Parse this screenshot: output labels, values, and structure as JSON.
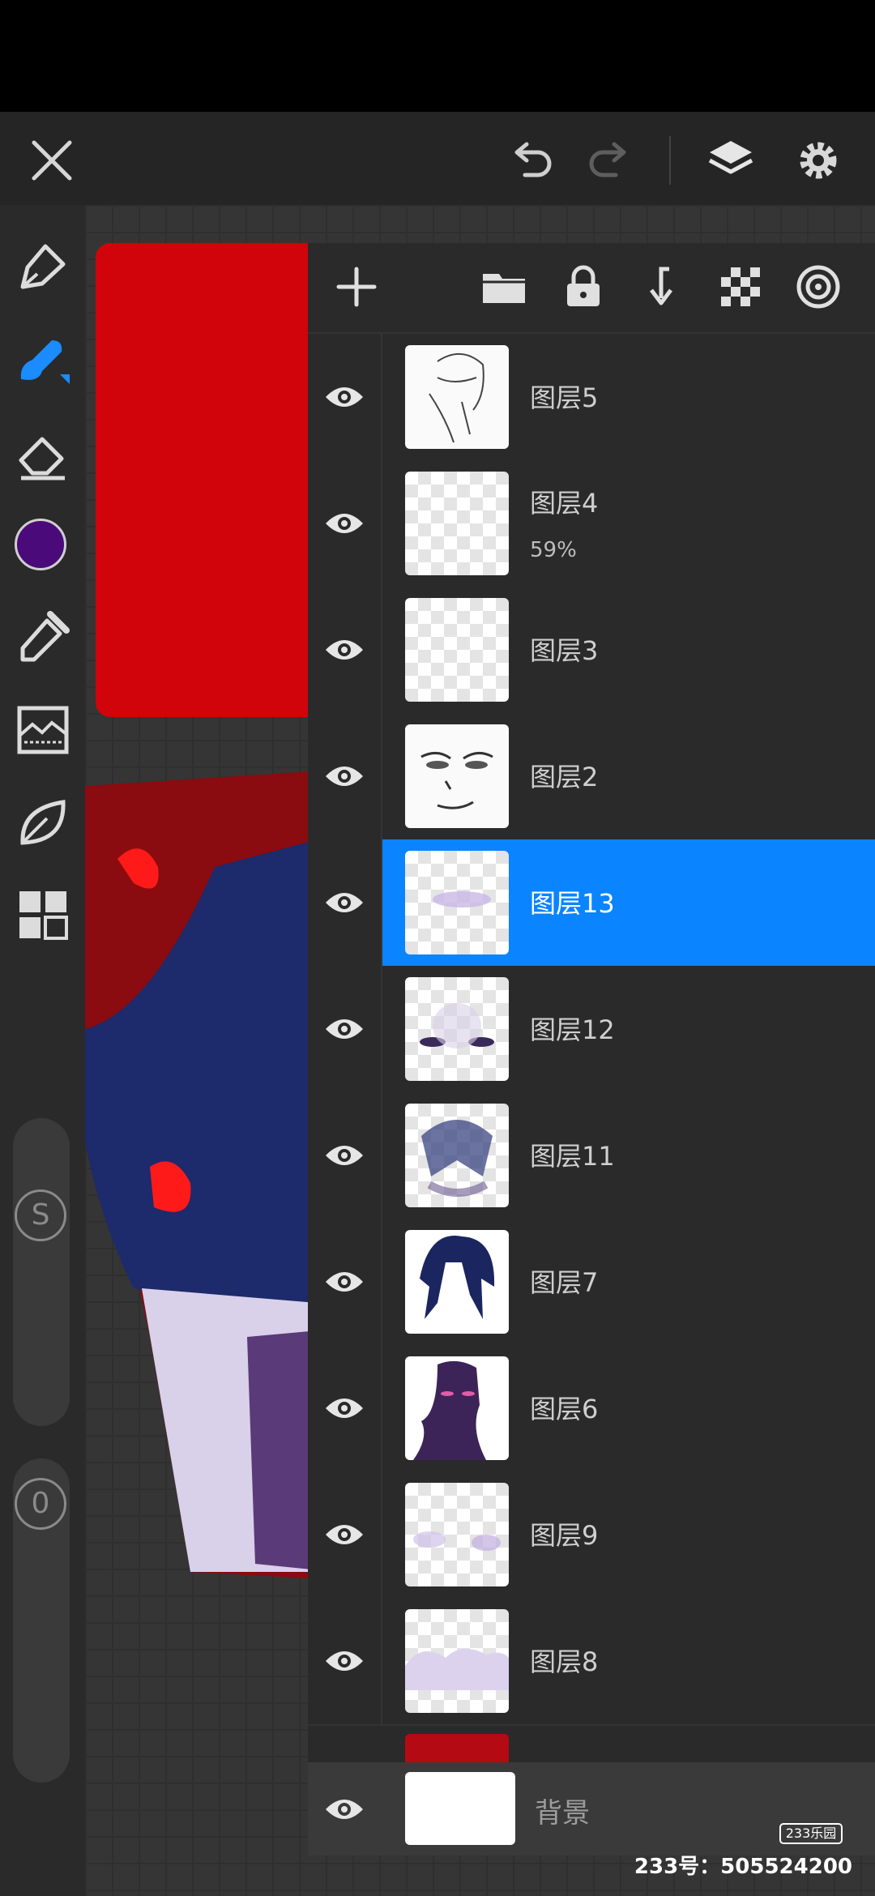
{
  "layers_panel": {
    "layers": [
      {
        "name": "图层5",
        "opacity": ""
      },
      {
        "name": "图层4",
        "opacity": "59%"
      },
      {
        "name": "图层3",
        "opacity": ""
      },
      {
        "name": "图层2",
        "opacity": ""
      },
      {
        "name": "图层13",
        "opacity": "",
        "selected": true
      },
      {
        "name": "图层12",
        "opacity": ""
      },
      {
        "name": "图层11",
        "opacity": ""
      },
      {
        "name": "图层7",
        "opacity": ""
      },
      {
        "name": "图层6",
        "opacity": ""
      },
      {
        "name": "图层9",
        "opacity": ""
      },
      {
        "name": "图层8",
        "opacity": ""
      }
    ],
    "background_label": "背景"
  },
  "watermark": {
    "logo": "233乐园",
    "id_text": "233号：505524200"
  },
  "colors": {
    "accent": "#0a84ff",
    "current_color": "#4b0a7a",
    "canvas_red": "#d0040a"
  },
  "sliders": {
    "size_label": "S",
    "opacity_label": "0"
  },
  "icons": {
    "top": [
      "close-icon",
      "undo-icon",
      "redo-icon",
      "layers-icon",
      "settings-icon"
    ],
    "panel": [
      "add-layer-icon",
      "folder-icon",
      "lock-icon",
      "merge-down-icon",
      "transparency-icon",
      "target-icon"
    ]
  }
}
